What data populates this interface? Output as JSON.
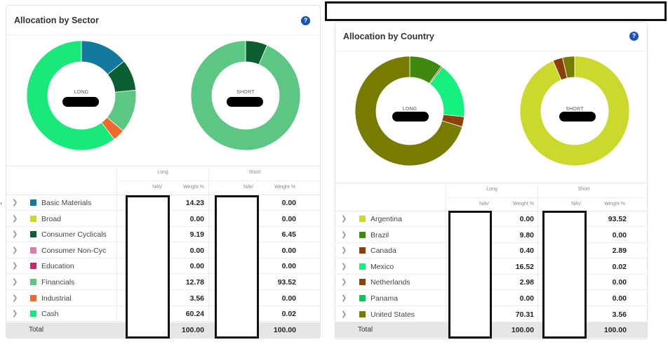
{
  "sector_panel": {
    "title": "Allocation by Sector",
    "help": "?",
    "long_label": "LONG",
    "short_label": "SHORT",
    "group_long": "Long",
    "group_short": "Short",
    "col_nav": "NAV",
    "col_weight": "Weight %",
    "total_label": "Total",
    "total_long": "100.00",
    "total_short": "100.00",
    "rows": [
      {
        "name": "Basic Materials",
        "color": "#137a9e",
        "long": "14.23",
        "short": "0.00"
      },
      {
        "name": "Broad",
        "color": "#cbd82a",
        "long": "0.00",
        "short": "0.00"
      },
      {
        "name": "Consumer Cyclicals",
        "color": "#0a5e31",
        "long": "9.19",
        "short": "6.45"
      },
      {
        "name": "Consumer Non-Cyc",
        "color": "#e27aa6",
        "long": "0.00",
        "short": "0.00"
      },
      {
        "name": "Education",
        "color": "#c9276b",
        "long": "0.00",
        "short": "0.00"
      },
      {
        "name": "Financials",
        "color": "#5cc784",
        "long": "12.78",
        "short": "93.52"
      },
      {
        "name": "Industrial",
        "color": "#f06a2e",
        "long": "3.56",
        "short": "0.00"
      },
      {
        "name": "Cash",
        "color": "#19e87a",
        "long": "60.24",
        "short": "0.02"
      }
    ]
  },
  "country_panel": {
    "title": "Allocation by Country",
    "help": "?",
    "long_label": "LONG",
    "short_label": "SHORT",
    "group_long": "Long",
    "group_short": "Short",
    "col_nav": "NAV",
    "col_weight": "Weight %",
    "total_label": "Total",
    "total_long": "100.00",
    "total_short": "100.00",
    "rows": [
      {
        "name": "Argentina",
        "color": "#cad92c",
        "long": "0.00",
        "short": "93.52"
      },
      {
        "name": "Brazil",
        "color": "#3f8a0e",
        "long": "9.80",
        "short": "0.00"
      },
      {
        "name": "Canada",
        "color": "#8a3f0a",
        "long": "0.40",
        "short": "2.89"
      },
      {
        "name": "Mexico",
        "color": "#16f07e",
        "long": "16.52",
        "short": "0.02"
      },
      {
        "name": "Netherlands",
        "color": "#8c4309",
        "long": "2.98",
        "short": "0.00"
      },
      {
        "name": "Panama",
        "color": "#12c45c",
        "long": "0.00",
        "short": "0.00"
      },
      {
        "name": "United States",
        "color": "#777b00",
        "long": "70.31",
        "short": "3.56"
      }
    ]
  }
}
